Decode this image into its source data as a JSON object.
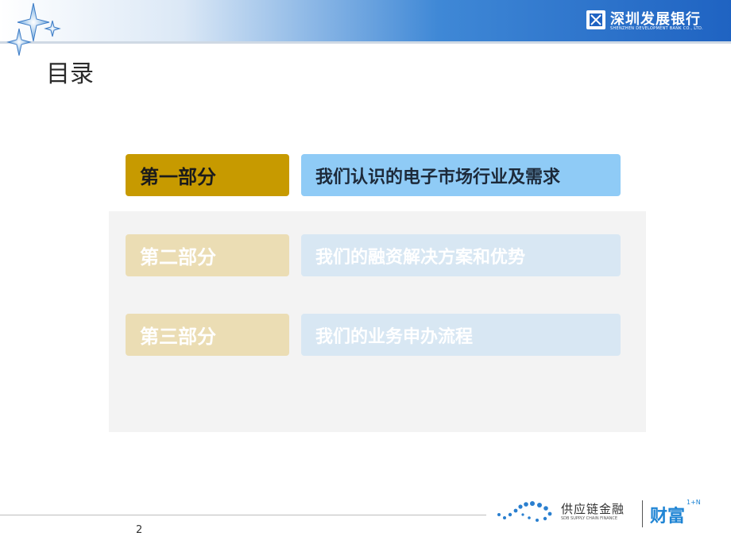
{
  "header": {
    "bank_name": "深圳发展银行",
    "bank_subtitle": "SHENZHEN DEVELOPMENT BANK CO., LTD."
  },
  "page_title": "目录",
  "toc": [
    {
      "part": "第一部分",
      "title": "我们认识的电子市场行业及需求",
      "active": true
    },
    {
      "part": "第二部分",
      "title": "我们的融资解决方案和优势",
      "active": false
    },
    {
      "part": "第三部分",
      "title": "我们的业务申办流程",
      "active": false
    }
  ],
  "footer": {
    "page_number": "2",
    "supply_chain_label": "供应链金融",
    "supply_chain_sub": "SDB SUPPLY CHAIN FINANCE",
    "wealth_label": "财富",
    "wealth_superscript": "1+N"
  },
  "colors": {
    "header_blue": "#1f63c2",
    "active_label": "#c79a00",
    "active_title": "#8fcbf6",
    "wealth_blue": "#1e84d4"
  }
}
